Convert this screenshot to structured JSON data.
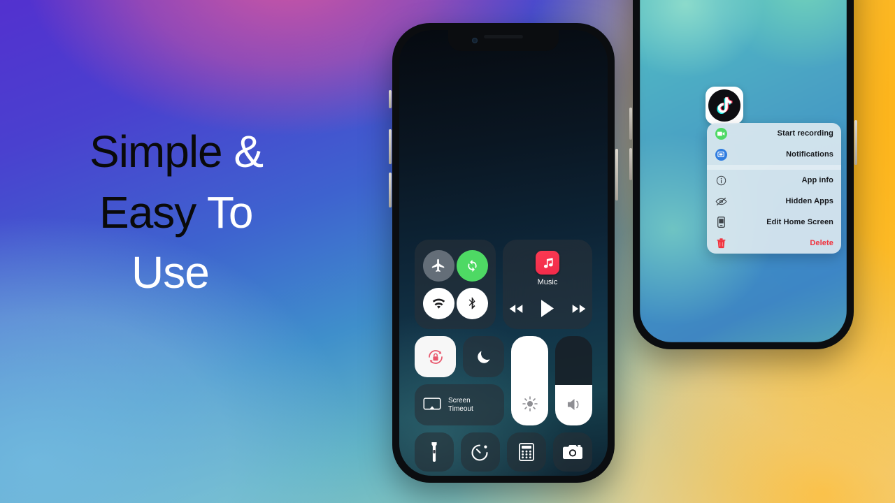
{
  "background": {
    "colors": {
      "top_left": "#5331cf",
      "top_mid_pink": "#d658a0",
      "top_right_orange": "#ffb214",
      "bottom_left_blue": "#78bee1",
      "bottom_right_peach": "#fcd796"
    }
  },
  "headline": {
    "line1": {
      "dark": "Simple",
      "light": "&"
    },
    "line2": {
      "dark": "Easy",
      "light": "To"
    },
    "line3": {
      "light": "Use"
    },
    "dark_color": "#0a0a0a",
    "light_color": "#ffffff"
  },
  "left_phone": {
    "name": "control-center-phone",
    "control_center": {
      "connectivity": [
        {
          "name": "airplane-mode",
          "icon": "airplane-icon",
          "state": "off"
        },
        {
          "name": "auto-rotate",
          "icon": "rotate-sync-icon",
          "state": "on-green"
        },
        {
          "name": "wifi",
          "icon": "wifi-icon",
          "state": "on"
        },
        {
          "name": "bluetooth",
          "icon": "bluetooth-icon",
          "state": "on"
        }
      ],
      "music": {
        "app_label": "Music",
        "icon": "music-note-icon",
        "icon_color": "#fb3a52",
        "controls": [
          {
            "name": "rewind-button",
            "icon": "rewind-icon"
          },
          {
            "name": "play-button",
            "icon": "play-icon"
          },
          {
            "name": "forward-button",
            "icon": "fast-forward-icon"
          }
        ]
      },
      "toggles": [
        {
          "name": "rotation-lock",
          "icon": "rotation-lock-icon",
          "state": "active",
          "accent": "#e8556b"
        },
        {
          "name": "do-not-disturb",
          "icon": "moon-icon",
          "state": "off"
        }
      ],
      "screen_mirroring": {
        "label_line1": "Screen",
        "label_line2": "Timeout",
        "icon": "screen-mirroring-icon"
      },
      "sliders": [
        {
          "name": "brightness-slider",
          "icon": "brightness-icon",
          "value": 100
        },
        {
          "name": "volume-slider",
          "icon": "volume-icon",
          "value": 45
        }
      ],
      "shortcuts": [
        {
          "name": "flashlight-button",
          "icon": "flashlight-icon"
        },
        {
          "name": "timer-button",
          "icon": "timer-icon"
        },
        {
          "name": "calculator-button",
          "icon": "calculator-icon"
        },
        {
          "name": "camera-button",
          "icon": "camera-icon"
        }
      ]
    }
  },
  "right_phone": {
    "name": "home-screen-phone",
    "app_icon": {
      "name": "tiktok-app-icon",
      "label": "TikTok"
    },
    "context_menu": {
      "items": [
        {
          "label": "Start recording",
          "icon": "video-record-icon",
          "icon_color": "#4ed964",
          "danger": false
        },
        {
          "label": "Notifications",
          "icon": "notifications-icon",
          "icon_color": "#2f7de0",
          "danger": false
        },
        {
          "label": "App info",
          "icon": "info-circle-icon",
          "icon_color": "#3d4348",
          "danger": false
        },
        {
          "label": "Hidden Apps",
          "icon": "eye-slash-icon",
          "icon_color": "#3d4348",
          "danger": false
        },
        {
          "label": "Edit Home Screen",
          "icon": "phone-edit-icon",
          "icon_color": "#3d4348",
          "danger": false
        },
        {
          "label": "Delete",
          "icon": "trash-icon",
          "icon_color": "#f0333e",
          "danger": true
        }
      ],
      "separator_after_index": 1
    }
  }
}
